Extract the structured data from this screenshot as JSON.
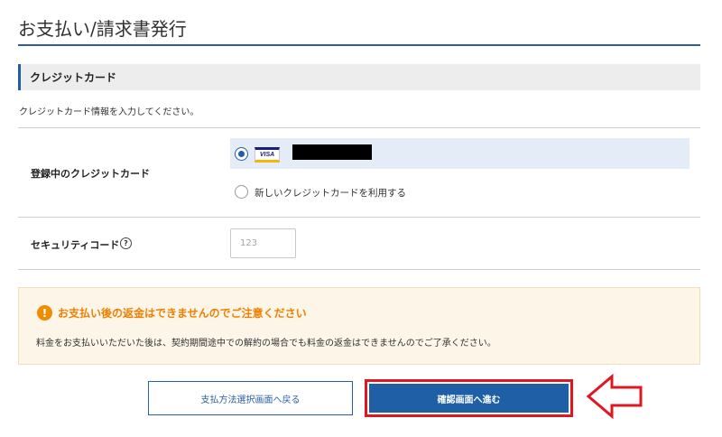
{
  "page": {
    "title": "お支払い/請求書発行"
  },
  "section": {
    "heading": "クレジットカード",
    "intro": "クレジットカード情報を入力してください。"
  },
  "registered_card": {
    "label": "登録中のクレジットカード",
    "brand": "VISA",
    "selected": true,
    "new_card_option": "新しいクレジットカードを利用する"
  },
  "security_code": {
    "label": "セキュリティコード",
    "help_icon": "question-circle-icon",
    "help_glyph": "?",
    "placeholder": "123"
  },
  "notice": {
    "icon": "exclamation-icon",
    "icon_glyph": "!",
    "title": "お支払い後の返金はできませんのでご注意ください",
    "body": "料金をお支払いいただいた後は、契約期間途中での解約の場合でも料金の返金はできませんのでご了承ください。"
  },
  "buttons": {
    "back": "支払方法選択画面へ戻る",
    "confirm": "確認画面へ進む"
  },
  "colors": {
    "accent": "#1e5fa6",
    "warning": "#ef7f00",
    "highlight": "#e01720"
  }
}
